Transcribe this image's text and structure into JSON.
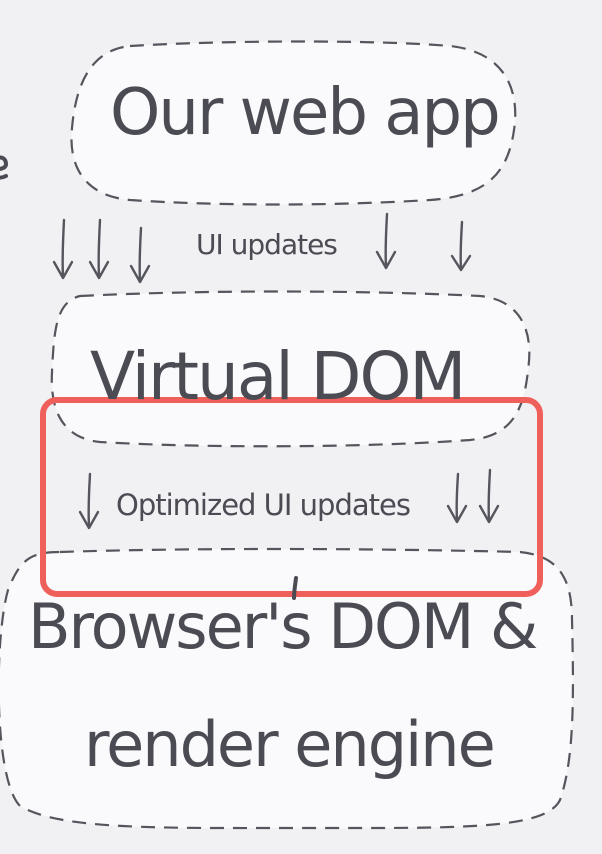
{
  "diagram": {
    "boxes": {
      "app": {
        "label": "Our web app"
      },
      "virtual_dom": {
        "label": "Virtual DOM"
      },
      "browser": {
        "line1": "Browser's DOM &",
        "line2": "render engine"
      }
    },
    "edges": {
      "ui_updates": {
        "label": "UI updates",
        "arrow_count": 5
      },
      "optimized_updates": {
        "label": "Optimized UI updates",
        "arrow_count": 3
      }
    },
    "highlight": {
      "color": "#f0605a",
      "target": "optimized_updates"
    },
    "colors": {
      "background": "#f1f1f4",
      "box_fill": "#fafafc",
      "stroke": "#55555d",
      "text": "#4b4b53"
    }
  }
}
